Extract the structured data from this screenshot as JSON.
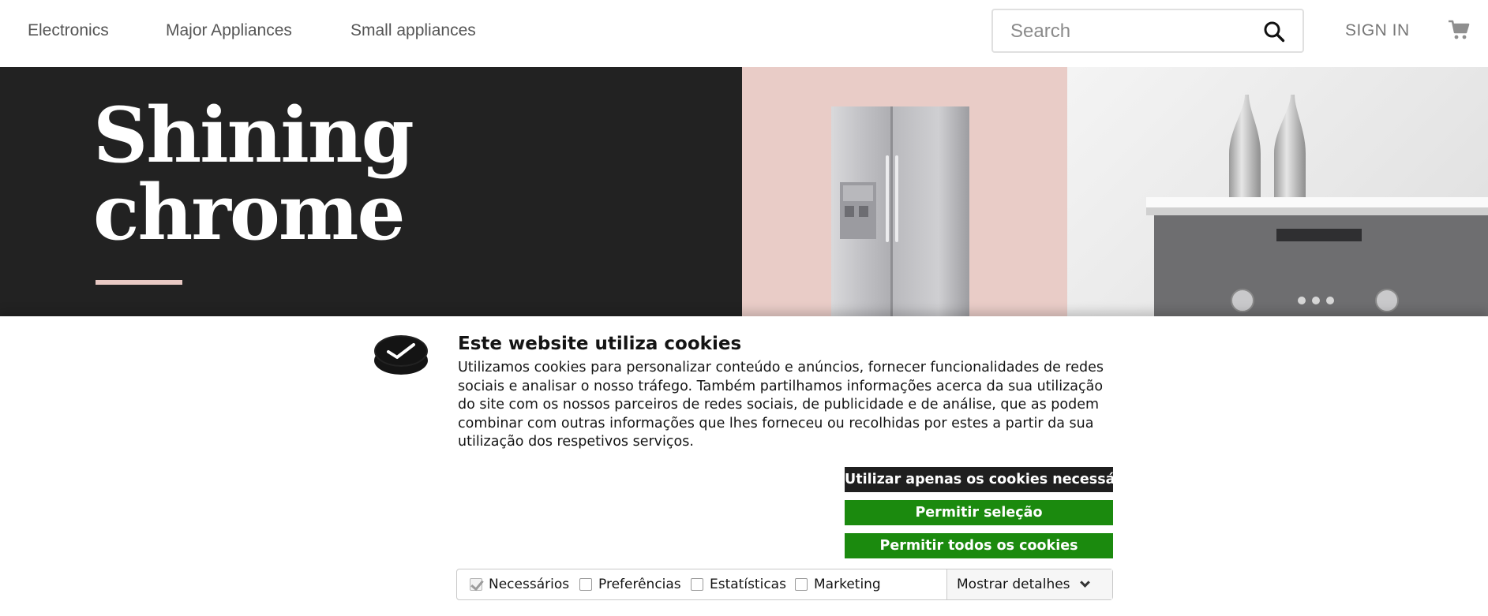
{
  "nav": {
    "items": [
      "Electronics",
      "Major Appliances",
      "Small appliances"
    ],
    "sign_in": "SIGN IN"
  },
  "search": {
    "placeholder": "Search",
    "value": ""
  },
  "icons": {
    "search": "search-icon",
    "cart": "cart-icon",
    "cookie_logo": "cookiebot-check-icon",
    "details_chevron": "chevron-down-icon"
  },
  "hero": {
    "title_line1": "Shining",
    "title_line2": "chrome",
    "colors": {
      "dark_panel": "#222222",
      "pink_panel": "#e9ccc7",
      "accent_rule": "#e9c9c4"
    }
  },
  "cookie_banner": {
    "title": "Este website utiliza cookies",
    "body": "Utilizamos cookies para personalizar conteúdo e anúncios, fornecer funcionalidades de redes sociais e analisar o nosso tráfego. Também partilhamos informações acerca da sua utilização do site com os nossos parceiros de redes sociais, de publicidade e de análise, que as podem combinar com outras informações que lhes forneceu ou recolhidas por estes a partir da sua utilização dos respetivos serviços.",
    "buttons": {
      "necessary": "Utilizar apenas os cookies necessários",
      "allow_selection": "Permitir seleção",
      "allow_all": "Permitir todos os cookies"
    },
    "categories": [
      {
        "label": "Necessários",
        "checked": true
      },
      {
        "label": "Preferências",
        "checked": false
      },
      {
        "label": "Estatísticas",
        "checked": false
      },
      {
        "label": "Marketing",
        "checked": false
      }
    ],
    "show_details": "Mostrar detalhes",
    "colors": {
      "dark_button": "#1f1f1f",
      "green_button": "#1b8a0e"
    }
  }
}
